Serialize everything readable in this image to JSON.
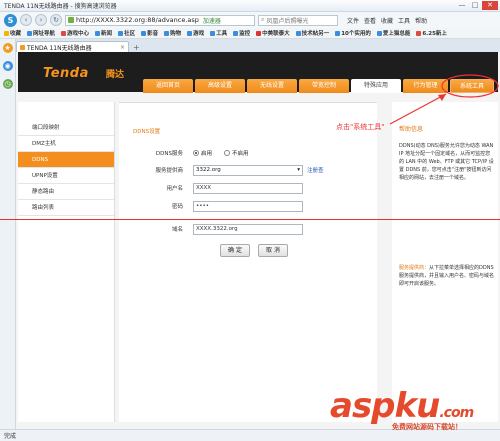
{
  "browser": {
    "title": "TENDA 11N无线路由器 - 搜狗高速浏览器",
    "window_controls": [
      "—",
      "□",
      "✕"
    ],
    "url": "http://XXXX.3322.org:88/advance.asp",
    "secure_label": "加速器",
    "search_placeholder": "凤凰卢后照曝光",
    "menus": [
      "文件",
      "查看",
      "收藏",
      "工具",
      "帮助"
    ],
    "favorites": [
      "收藏",
      "网址导航",
      "游戏中心",
      "新闻",
      "社区",
      "影音",
      "购物",
      "游戏",
      "工具",
      "监控",
      "中美联泰大",
      "技术帖另一",
      "10个实用的",
      "爱上猫总能",
      "6.25新上"
    ],
    "tab_label": "TENDA 11N无线路由器",
    "tab_close": "×",
    "tab_add": "+",
    "status": "完成"
  },
  "router": {
    "brand": "Tenda",
    "brand_cn": "腾达",
    "nav_tabs": [
      "返回首页",
      "高级设置",
      "无线设置",
      "带宽控制",
      "特殊应用",
      "行为管理",
      "系统工具"
    ],
    "active_nav": "特殊应用",
    "left_menu": [
      "端口段映射",
      "DMZ主机",
      "DDNS",
      "UPNP设置",
      "静态路由",
      "路由列表"
    ],
    "active_left": "DDNS",
    "section_title": "DDNS设置",
    "form": {
      "ddns_label": "DDNS服务",
      "enable_label": "启用",
      "disable_label": "不启用",
      "provider_label": "服务提供商",
      "provider_value": "3322.org",
      "register_link": "注册查",
      "username_label": "用户名",
      "username_value": "XXXX",
      "password_label": "密码",
      "password_value": "••••",
      "domain_label": "域名",
      "domain_value": "XXXX.3322.org"
    },
    "ok_button": "确 定",
    "cancel_button": "取 消",
    "help_title": "帮助信息",
    "help_text": "DDNS(动态 DNS)服务允许您为动态 WAN IP 地址分配一个固定域名，从而可监控您的 LAN 中的 Web、FTP 或其它 TCP/IP 设置 DDNS 前，您可点击\"注册\"按钮到访问相应的网站，去注册一个域名。",
    "help_note_label": "服务提供商：",
    "help_note_text": "从下拉菜单选择相应的DDNS服务提供商，并且输入用户名、密码与域名 即可开启该服务。"
  },
  "annotation": "点击\"系统工具\"",
  "watermark": "aspku",
  "watermark_suffix": ".com",
  "watermark_sub": "免费网站源码下载站！"
}
